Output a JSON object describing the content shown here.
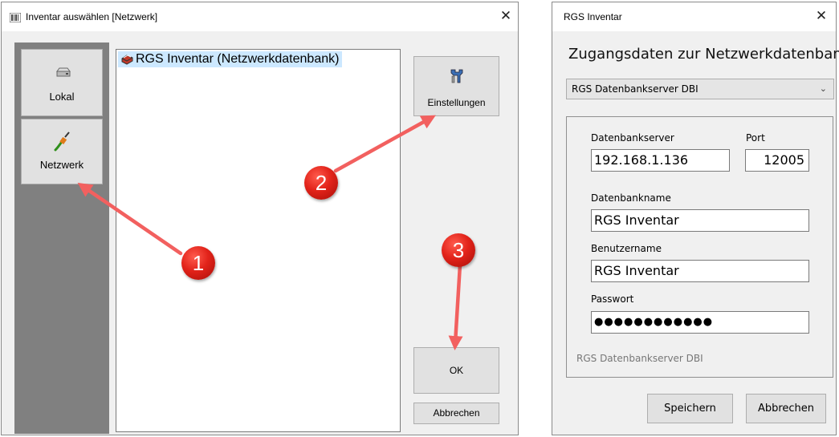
{
  "dialog1": {
    "title": "Inventar auswählen  [Netzwerk]",
    "close": "✕",
    "nav": [
      {
        "label": "Lokal",
        "icon": "disk-drive-icon"
      },
      {
        "label": "Netzwerk",
        "icon": "network-cable-icon"
      }
    ],
    "list_items": [
      "RGS Inventar (Netzwerkdatenbank)"
    ],
    "settings_label": "Einstellungen",
    "ok_label": "OK",
    "cancel_label": "Abbrechen"
  },
  "annotations": {
    "step1": "1",
    "step2": "2",
    "step3": "3",
    "color": "#e2231a"
  },
  "dialog2": {
    "title": "RGS Inventar",
    "close": "✕",
    "heading": "Zugangsdaten zur Netzwerkdatenbank",
    "server_type": "RGS Datenbankserver DBI",
    "fields": {
      "server_label": "Datenbankserver",
      "server_value": "192.168.1.136",
      "port_label": "Port",
      "port_value": "12005",
      "dbname_label": "Datenbankname",
      "dbname_value": "RGS Inventar",
      "user_label": "Benutzername",
      "user_value": "RGS Inventar",
      "password_label": "Passwort",
      "password_value": "●●●●●●●●●●●●"
    },
    "status": "RGS Datenbankserver DBI",
    "save_label": "Speichern",
    "cancel_label": "Abbrechen"
  }
}
